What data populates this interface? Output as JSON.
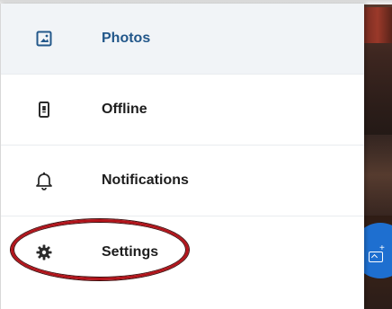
{
  "drawer": {
    "items": [
      {
        "label": "Photos",
        "icon": "photo-icon",
        "active": true
      },
      {
        "label": "Offline",
        "icon": "offline-device-icon",
        "active": false
      },
      {
        "label": "Notifications",
        "icon": "bell-icon",
        "active": false
      },
      {
        "label": "Settings",
        "icon": "gear-icon",
        "active": false
      }
    ],
    "active_color": "#22578a",
    "active_background": "#f1f4f7"
  },
  "annotation": {
    "highlight_color": "#b3141b",
    "target": "Settings"
  },
  "background_app": {
    "fab_color": "#1e6fd0",
    "fab_icon": "add-photo-icon"
  }
}
